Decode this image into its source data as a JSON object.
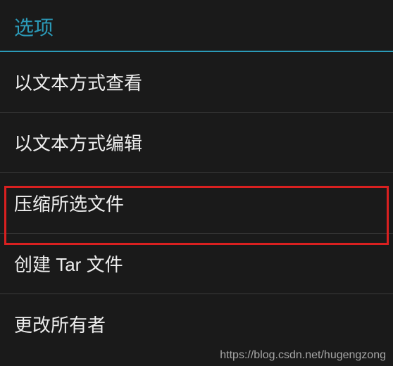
{
  "header": {
    "title": "选项"
  },
  "menu": {
    "items": [
      {
        "label": "以文本方式查看"
      },
      {
        "label": "以文本方式编辑"
      },
      {
        "label": "压缩所选文件"
      },
      {
        "label": "创建 Tar 文件"
      },
      {
        "label": "更改所有者"
      }
    ]
  },
  "watermark": "https://blog.csdn.net/hugengzong"
}
